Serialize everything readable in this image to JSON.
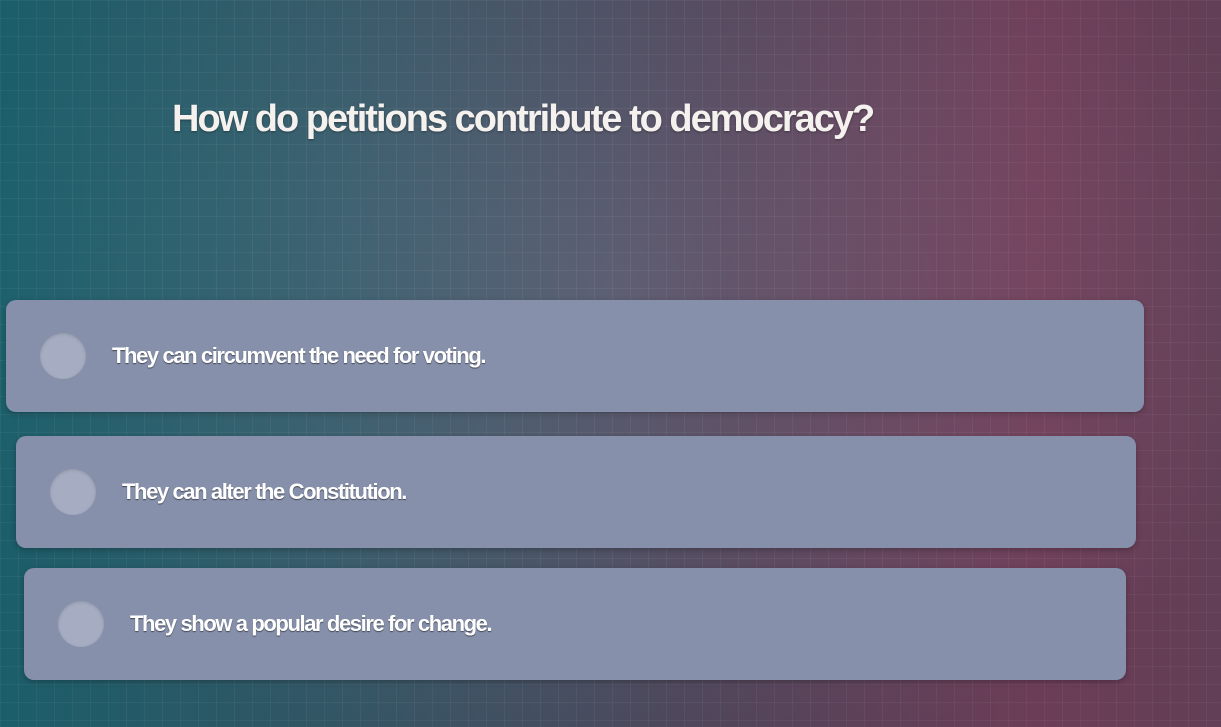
{
  "question": {
    "text": "How do petitions contribute to democracy?"
  },
  "answers": [
    {
      "label": "They can circumvent the need for voting.",
      "selected": false
    },
    {
      "label": "They can alter the Constitution.",
      "selected": false
    },
    {
      "label": "They show a popular desire for change.",
      "selected": false
    }
  ],
  "colors": {
    "answer_background": "#8690aa",
    "radio_fill": "#a6adc2",
    "text": "#ffffff"
  }
}
